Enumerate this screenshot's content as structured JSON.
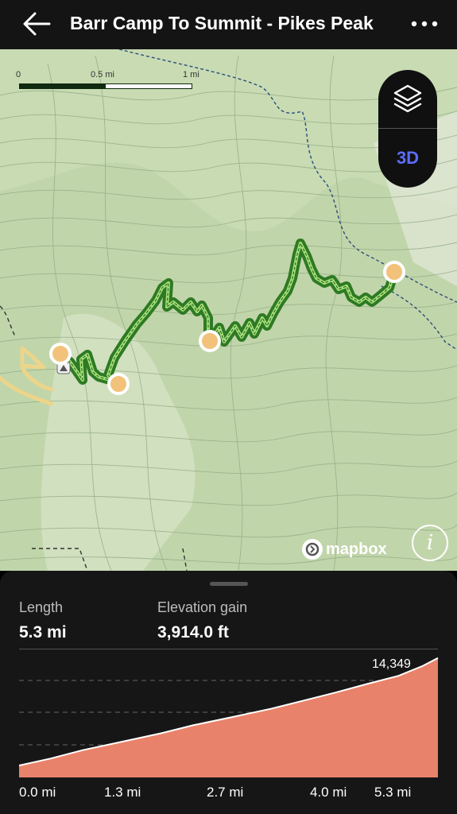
{
  "header": {
    "title": "Barr Camp To Summit - Pikes Peak",
    "back_icon": "arrow-left-icon",
    "more_icon": "more-horizontal-icon"
  },
  "map": {
    "scale": {
      "labels": [
        "0",
        "0.5 mi",
        "1 mi"
      ]
    },
    "controls": {
      "layers_icon": "layers-icon",
      "threed_label": "3D"
    },
    "attribution": {
      "logo_text": "mapbox",
      "info_label": "i"
    },
    "colors": {
      "trail": "#2e8a2e",
      "trail_highlight": "#a6e07a",
      "waypoint": "#f2c27a",
      "road": "#ecd58a"
    }
  },
  "stats": {
    "length_label": "Length",
    "length_value": "5.3 mi",
    "gain_label": "Elevation gain",
    "gain_value": "3,914.0 ft"
  },
  "chart_data": {
    "type": "area",
    "x": [
      0,
      0.4,
      0.8,
      1.3,
      1.8,
      2.2,
      2.7,
      3.2,
      3.6,
      4.0,
      4.4,
      4.8,
      5.1,
      5.3
    ],
    "y": [
      10435,
      10690,
      10990,
      11300,
      11610,
      11900,
      12200,
      12510,
      12800,
      13090,
      13400,
      13700,
      14050,
      14349
    ],
    "xticks": [
      "0.0 mi",
      "1.3 mi",
      "2.7 mi",
      "4.0 mi",
      "5.3 mi"
    ],
    "max_label": "14,349",
    "fill_color": "#e9826a",
    "line_color": "#ffffff",
    "grid": "dashed horizontal"
  }
}
